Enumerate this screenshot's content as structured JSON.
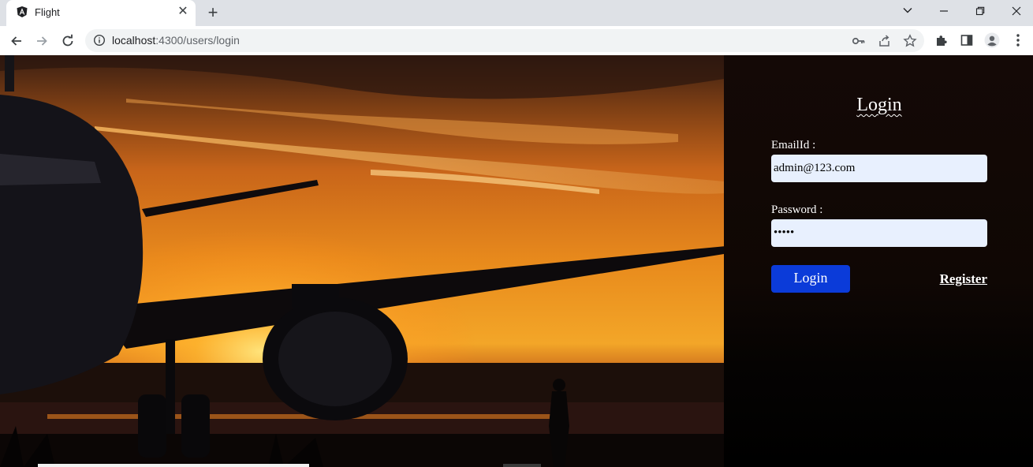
{
  "browser": {
    "tab_title": "Flight",
    "url_host": "localhost",
    "url_path": ":4300/users/login",
    "icons": {
      "favicon": "angular-logo-icon",
      "close": "close-icon",
      "new_tab": "plus-icon",
      "back": "arrow-left-icon",
      "forward": "arrow-right-icon",
      "reload": "reload-icon",
      "info": "info-icon",
      "key": "key-icon",
      "share": "share-icon",
      "star": "star-icon",
      "extensions": "puzzle-icon",
      "side_panel": "side-panel-icon",
      "profile": "profile-icon",
      "menu": "kebab-menu-icon"
    }
  },
  "hero_image": {
    "description_icon": "airplane-sunset-photo"
  },
  "login": {
    "title": "Login",
    "email_label": "EmailId :",
    "email_value": "admin@123.com",
    "password_label": "Password :",
    "password_value": "•••••",
    "submit_label": "Login",
    "register_label": "Register"
  },
  "colors": {
    "panel_bg": "#0f0704",
    "input_bg": "#e8f0fe",
    "button_bg": "#0b3bd9",
    "text": "#ffffff"
  }
}
